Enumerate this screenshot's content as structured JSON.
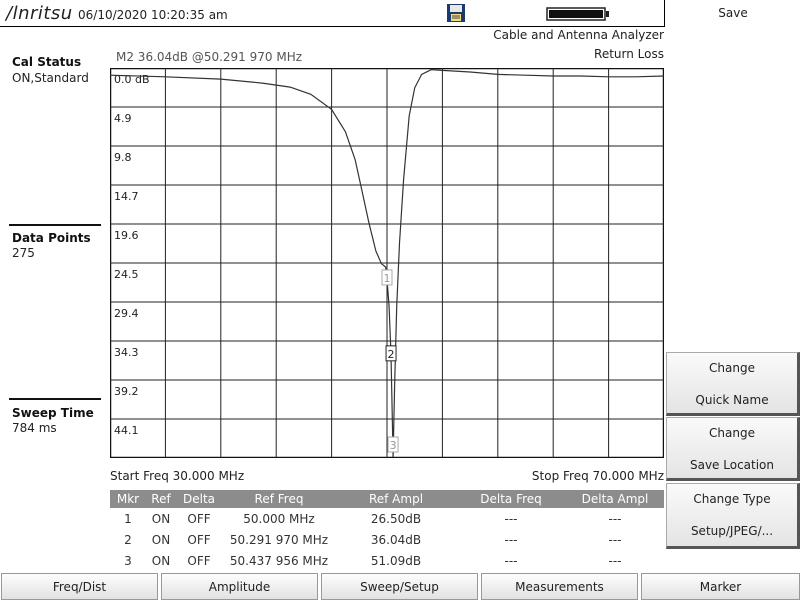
{
  "header": {
    "logo": "/lnritsu",
    "datetime": "06/10/2020 10:20:35 am"
  },
  "mode": {
    "title": "Cable and Antenna Analyzer",
    "measurement": "Return Loss"
  },
  "marker_readout": "M2 36.04dB @50.291 970 MHz",
  "sidebar": {
    "cal_status_label": "Cal Status",
    "cal_status_value": "ON,Standard",
    "data_points_label": "Data Points",
    "data_points_value": "275",
    "sweep_time_label": "Sweep Time",
    "sweep_time_value": "784 ms"
  },
  "trace": {
    "start_freq": "Start Freq 30.000 MHz",
    "stop_freq": "Stop Freq 70.000 MHz",
    "y_labels": [
      "0.0 dB",
      "4.9",
      "9.8",
      "14.7",
      "19.6",
      "24.5",
      "29.4",
      "34.3",
      "39.2",
      "44.1"
    ],
    "trace_color": "#333333"
  },
  "chart_data": {
    "type": "line",
    "title": "Return Loss",
    "xlabel": "",
    "ylabel": "",
    "x_unit": "MHz",
    "xlim": [
      30.0,
      70.0
    ],
    "ylim": [
      0.0,
      49.0
    ],
    "y_inverted": true,
    "grid": true,
    "series": [
      {
        "name": "",
        "x": [
          30,
          34,
          38,
          41,
          43,
          44.5,
          46,
          47,
          47.7,
          48.2,
          48.7,
          49.2,
          49.6,
          49.9,
          50.0,
          50.15,
          50.29,
          50.44,
          50.55,
          50.7,
          50.9,
          51.2,
          51.6,
          52.0,
          52.5,
          53.2,
          54,
          56,
          58,
          60,
          62,
          64,
          66,
          68,
          70
        ],
        "y": [
          0.9,
          1.1,
          1.4,
          1.9,
          2.4,
          3.3,
          5.2,
          8.0,
          11.5,
          15.5,
          19.5,
          23.0,
          24.6,
          25.0,
          26.5,
          30.0,
          36.04,
          51.09,
          40.0,
          30.0,
          22.0,
          14.0,
          6.0,
          2.5,
          0.8,
          0.2,
          0.3,
          0.5,
          0.8,
          0.9,
          1.0,
          1.0,
          1.1,
          1.1,
          1.0
        ]
      }
    ],
    "markers": [
      {
        "label": "1",
        "x": 50.0,
        "y": 26.5
      },
      {
        "label": "2",
        "x": 50.29197,
        "y": 36.04
      },
      {
        "label": "3",
        "x": 50.437956,
        "y": 51.09
      }
    ]
  },
  "marker_table": {
    "headers": [
      "Mkr",
      "Ref",
      "Delta",
      "Ref Freq",
      "Ref Ampl",
      "Delta Freq",
      "Delta Ampl"
    ],
    "rows": [
      [
        "1",
        "ON",
        "OFF",
        "50.000 MHz",
        "26.50dB",
        "---",
        "---"
      ],
      [
        "2",
        "ON",
        "OFF",
        "50.291 970 MHz",
        "36.04dB",
        "---",
        "---"
      ],
      [
        "3",
        "ON",
        "OFF",
        "50.437 956 MHz",
        "51.09dB",
        "---",
        "---"
      ]
    ]
  },
  "softkeys": {
    "title": "Save",
    "quick_name_1": "Change",
    "quick_name_2": "Quick Name",
    "location_1": "Change",
    "location_2": "Save Location",
    "type_1": "Change Type",
    "type_2": "Setup/JPEG/..."
  },
  "menu": [
    "Freq/Dist",
    "Amplitude",
    "Sweep/Setup",
    "Measurements",
    "Marker"
  ]
}
